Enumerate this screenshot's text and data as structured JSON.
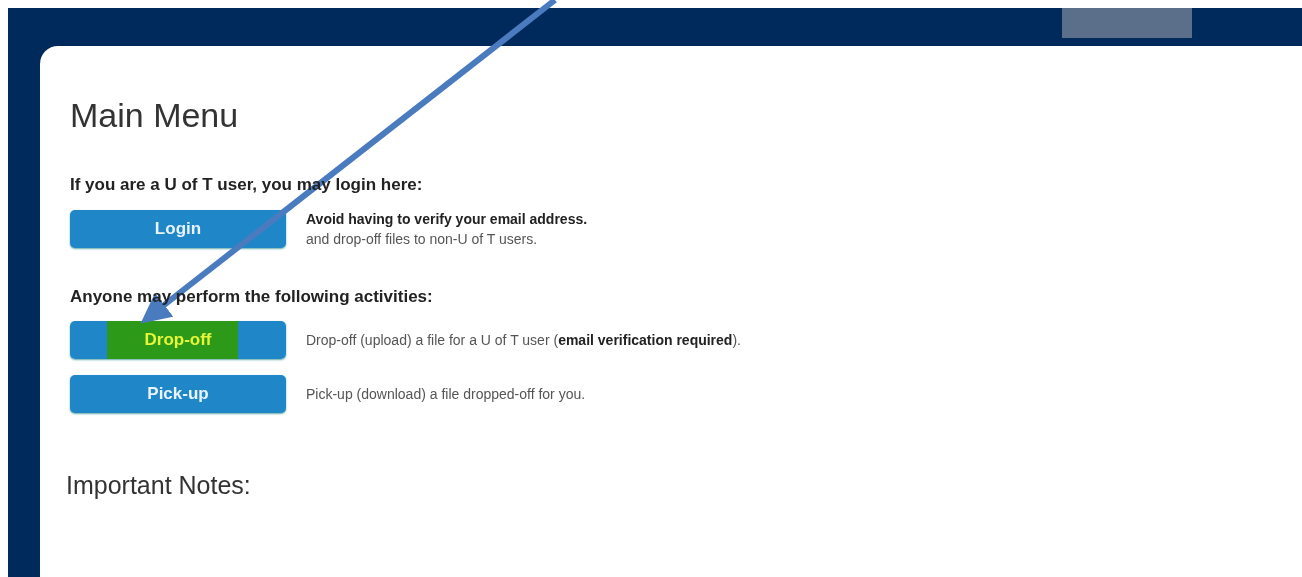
{
  "heading": "Main Menu",
  "sections": [
    {
      "title": "If you are a U of T user, you may login here:",
      "actions": [
        {
          "label": "Login",
          "highlighted": false,
          "description": "Avoid having to verify your email address.",
          "note": "and drop-off files to non-U of T users."
        }
      ]
    },
    {
      "title": "Anyone may perform the following activities:",
      "actions": [
        {
          "label": "Drop-off",
          "highlighted": true,
          "description": "Drop-off (upload) a file for a U of T user (**email verification required**)."
        },
        {
          "label": "Pick-up",
          "highlighted": false,
          "description": "Pick-up (download) a file dropped-off for you."
        }
      ]
    }
  ],
  "notes_heading": "Important Notes:"
}
